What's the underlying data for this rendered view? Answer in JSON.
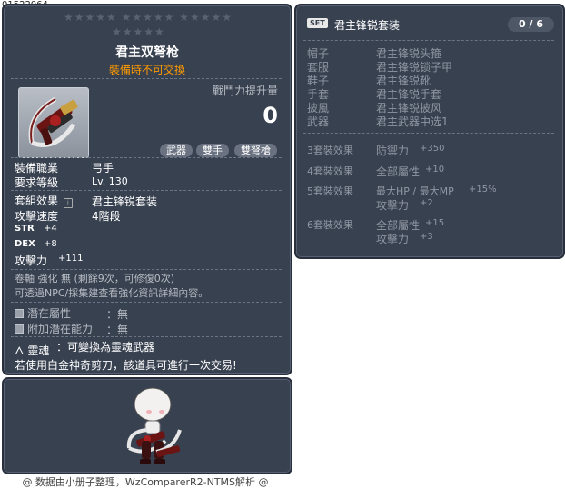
{
  "item_id": "01522064",
  "stars_row1": "★★★★★ ★★★★★ ★★★★★",
  "stars_row2": "★★★★★",
  "name": "君主双弩枪",
  "untradeable": "裝備時不可交換",
  "combat_power_label": "戰鬥力提升量",
  "combat_power_value": "0",
  "tags": [
    "武器",
    "雙手",
    "雙弩槍"
  ],
  "req_job_label": "裝備職業",
  "req_job_value": "弓手",
  "req_level_label": "要求等級",
  "req_level_value": "Lv. 130",
  "set_label": "套組效果",
  "set_value": "君主锋锐套装",
  "speed_label": "攻擊速度",
  "speed_value": "4階段",
  "stats": [
    {
      "name": "STR",
      "value": "+4"
    },
    {
      "name": "DEX",
      "value": "+8"
    },
    {
      "name": "攻擊力",
      "value": "+111"
    }
  ],
  "upgrade_line": "卷軸 強化 無 (剩餘9次，可修復0次)",
  "upgrade_hint": "可透過NPC/採集建查看強化資訊詳細內容。",
  "potential_label": "潛在屬性",
  "potential_value": "：無",
  "bonus_potential_label": "附加潛在能力",
  "bonus_potential_value": "：無",
  "soul_label": "靈魂",
  "soul_value": "：可變換為靈魂武器",
  "platinum_hint": "若使用白金神奇剪刀，該道具可進行一次交易!",
  "footer": "@ 数据由小册子整理，WzComparerR2-NTMS解析 @",
  "set_panel": {
    "badge": "SET",
    "title": "君主锋锐套装",
    "count": "0 / 6",
    "parts": [
      {
        "slot": "帽子",
        "item": "君主锋锐头箍"
      },
      {
        "slot": "套服",
        "item": "君主锋锐锁子甲"
      },
      {
        "slot": "鞋子",
        "item": "君主锋锐靴"
      },
      {
        "slot": "手套",
        "item": "君主锋锐手套"
      },
      {
        "slot": "披風",
        "item": "君主锋锐披风"
      },
      {
        "slot": "武器",
        "item": "君主武器中选1"
      }
    ],
    "effects": [
      {
        "label": "3套裝效果",
        "lines": [
          [
            "防禦力",
            "+350"
          ]
        ]
      },
      {
        "label": "4套裝效果",
        "lines": [
          [
            "全部屬性",
            "+10"
          ]
        ]
      },
      {
        "label": "5套裝效果",
        "lines": [
          [
            "最大HP / 最大MP",
            "+15%"
          ],
          [
            "攻擊力",
            "+2"
          ]
        ]
      },
      {
        "label": "6套裝效果",
        "lines": [
          [
            "全部屬性",
            "+15"
          ],
          [
            "攻擊力",
            "+3"
          ]
        ]
      }
    ]
  },
  "colors": {
    "panel_bg": "#384150",
    "orange": "#ff9a00",
    "grey_text": "#b7bcc4"
  }
}
